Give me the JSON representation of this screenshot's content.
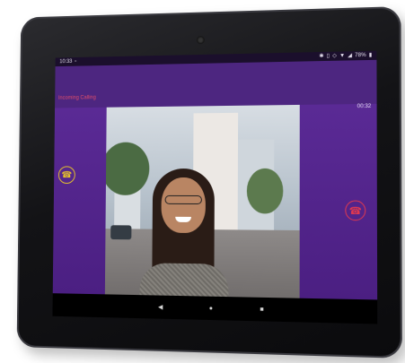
{
  "status_bar": {
    "time": "10:33",
    "notification_icon": "sim-icon",
    "right_icons": [
      "bluetooth-icon",
      "vibrate-icon",
      "location-icon",
      "wifi-icon",
      "signal-icon"
    ],
    "battery": "78%",
    "battery_icon": "battery-icon"
  },
  "call": {
    "title": "Incoming Calling",
    "duration": "00:32",
    "accept_icon": "phone-accept-icon",
    "reject_icon": "phone-hangup-icon"
  },
  "nav": {
    "back_icon": "back-icon",
    "home_icon": "home-icon",
    "recents_icon": "recents-icon"
  },
  "colors": {
    "screen_bg": "#4a1f7e",
    "accept": "#e6c32a",
    "reject": "#e0394f",
    "title": "#e24d6a"
  }
}
